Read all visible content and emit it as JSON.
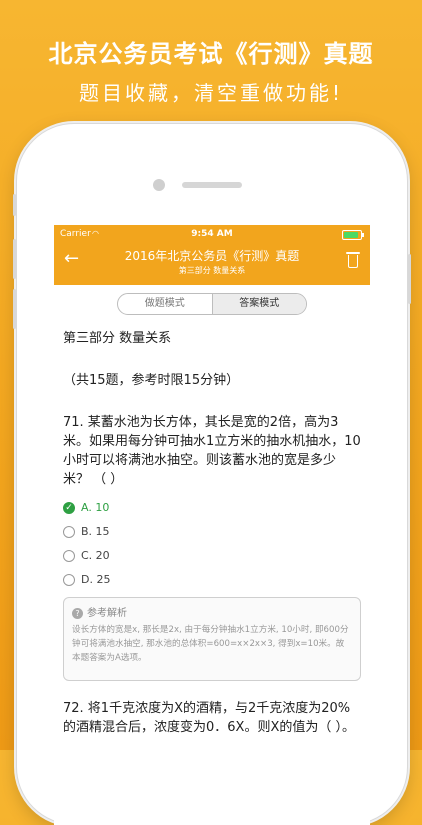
{
  "promo": {
    "title": "北京公务员考试《行测》真题",
    "subtitle": "题目收藏，清空重做功能!"
  },
  "status": {
    "carrier": "Carrier",
    "time": "9:54 AM"
  },
  "nav": {
    "title": "2016年北京公务员《行测》真题",
    "subtitle": "第三部分 数量关系"
  },
  "segment": {
    "options": [
      "做题模式",
      "答案模式"
    ],
    "selected": "答案模式"
  },
  "content": {
    "section_title": "第三部分 数量关系",
    "section_info": "（共15题，参考时限15分钟）",
    "question71": {
      "text": "71. 某蓄水池为长方体，其长是宽的2倍，高为3米。如果用每分钟可抽水1立方米的抽水机抽水，10小时可以将满池水抽空。则该蓄水池的宽是多少米？ （ ）",
      "options": [
        {
          "label": "A. 10",
          "correct": true
        },
        {
          "label": "B. 15",
          "correct": false
        },
        {
          "label": "C. 20",
          "correct": false
        },
        {
          "label": "D. 25",
          "correct": false
        }
      ]
    },
    "analysis": {
      "title": "参考解析",
      "text": "设长方体的宽是x, 那长是2x, 由于每分钟抽水1立方米, 10小时, 即600分钟可将满池水抽空, 那水池的总体积=600=x×2x×3, 得到x=10米。故本题答案为A选项。"
    },
    "question72": {
      "text": "72. 将1千克浓度为X的酒精，与2千克浓度为20%的酒精混合后，浓度变为0．6X。则X的值为（ ）。"
    }
  }
}
